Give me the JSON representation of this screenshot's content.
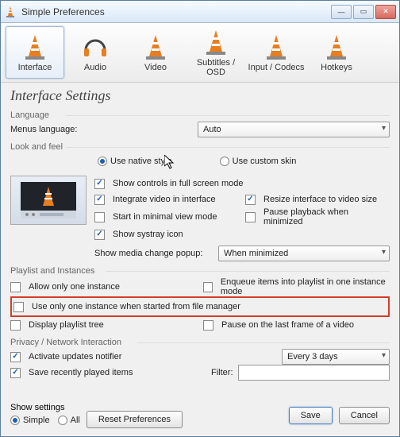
{
  "window": {
    "title": "Simple Preferences"
  },
  "tabs": [
    {
      "label": "Interface"
    },
    {
      "label": "Audio"
    },
    {
      "label": "Video"
    },
    {
      "label": "Subtitles / OSD"
    },
    {
      "label": "Input / Codecs"
    },
    {
      "label": "Hotkeys"
    }
  ],
  "heading": "Interface Settings",
  "language": {
    "group": "Language",
    "menus_label": "Menus language:",
    "value": "Auto"
  },
  "look": {
    "group": "Look and feel",
    "native": "Use native style",
    "custom": "Use custom skin",
    "fullscreen": "Show controls in full screen mode",
    "integrate": "Integrate video in interface",
    "resize": "Resize interface to video size",
    "minimal": "Start in minimal view mode",
    "pause_min": "Pause playback when minimized",
    "systray": "Show systray icon",
    "popup_label": "Show media change popup:",
    "popup_value": "When minimized"
  },
  "playlist": {
    "group": "Playlist and Instances",
    "one_instance": "Allow only one instance",
    "enqueue": "Enqueue items into playlist in one instance mode",
    "one_from_fm": "Use only one instance when started from file manager",
    "tree": "Display playlist tree",
    "pause_last": "Pause on the last frame of a video"
  },
  "privacy": {
    "group": "Privacy / Network Interaction",
    "updates": "Activate updates notifier",
    "update_freq": "Every 3 days",
    "save_recent": "Save recently played items",
    "filter_label": "Filter:",
    "filter_value": ""
  },
  "footer": {
    "show_settings": "Show settings",
    "simple": "Simple",
    "all": "All",
    "reset": "Reset Preferences",
    "save": "Save",
    "cancel": "Cancel"
  }
}
